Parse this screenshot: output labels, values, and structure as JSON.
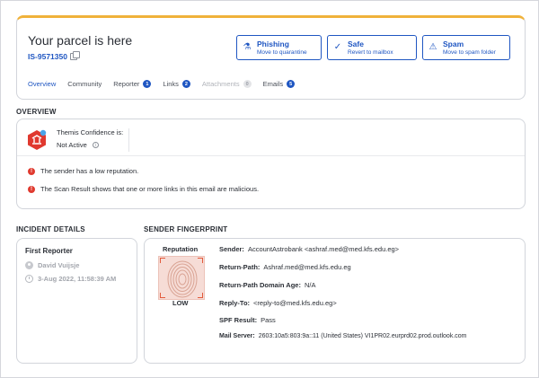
{
  "header": {
    "title": "Your parcel is here",
    "case_id": "IS-9571350",
    "actions": [
      {
        "icon": "phishing-hook-icon",
        "label": "Phishing",
        "sub": "Move to quarantine"
      },
      {
        "icon": "check-icon",
        "label": "Safe",
        "sub": "Revert to mailbox"
      },
      {
        "icon": "warning-icon",
        "label": "Spam",
        "sub": "Move to spam folder"
      }
    ],
    "tabs": [
      {
        "label": "Overview",
        "count": null,
        "active": true
      },
      {
        "label": "Community",
        "count": null
      },
      {
        "label": "Reporter",
        "count": "1"
      },
      {
        "label": "Links",
        "count": "2"
      },
      {
        "label": "Attachments",
        "count": "0",
        "disabled": true
      },
      {
        "label": "Emails",
        "count": "5"
      }
    ]
  },
  "overview": {
    "section_label": "OVERVIEW",
    "themis_label": "Themis Confidence is:",
    "themis_status": "Not Active",
    "alerts": [
      "The sender has a low reputation.",
      "The Scan Result shows that one or more links in this email are malicious."
    ]
  },
  "incident": {
    "section_label": "INCIDENT DETAILS",
    "title": "First Reporter",
    "reporter_name": "David Vuijsje",
    "reported_at": "3-Aug 2022, 11:58:39 AM"
  },
  "sender": {
    "section_label": "SENDER FINGERPRINT",
    "reputation_label": "Reputation",
    "reputation_value": "LOW",
    "fields": [
      {
        "label": "Sender:",
        "value": "AccountAstrobank <ashraf.med@med.kfs.edu.eg>"
      },
      {
        "label": "Return-Path:",
        "value": "Ashraf.med@med.kfs.edu.eg"
      },
      {
        "label": "Return-Path Domain Age:",
        "value": "N/A"
      },
      {
        "label": "Reply-To:",
        "value": "<reply-to@med.kfs.edu.eg>"
      },
      {
        "label": "SPF Result:",
        "value": "Pass"
      },
      {
        "label": "Mail Server:",
        "value": "2603:10a5:803:9a::11 (United States) VI1PR02.eurprd02.prod.outlook.com"
      }
    ]
  },
  "colors": {
    "accent": "#1f56c2",
    "top_border": "#f0b23a",
    "alert": "#e03a2f",
    "themis": "#e0392f"
  }
}
